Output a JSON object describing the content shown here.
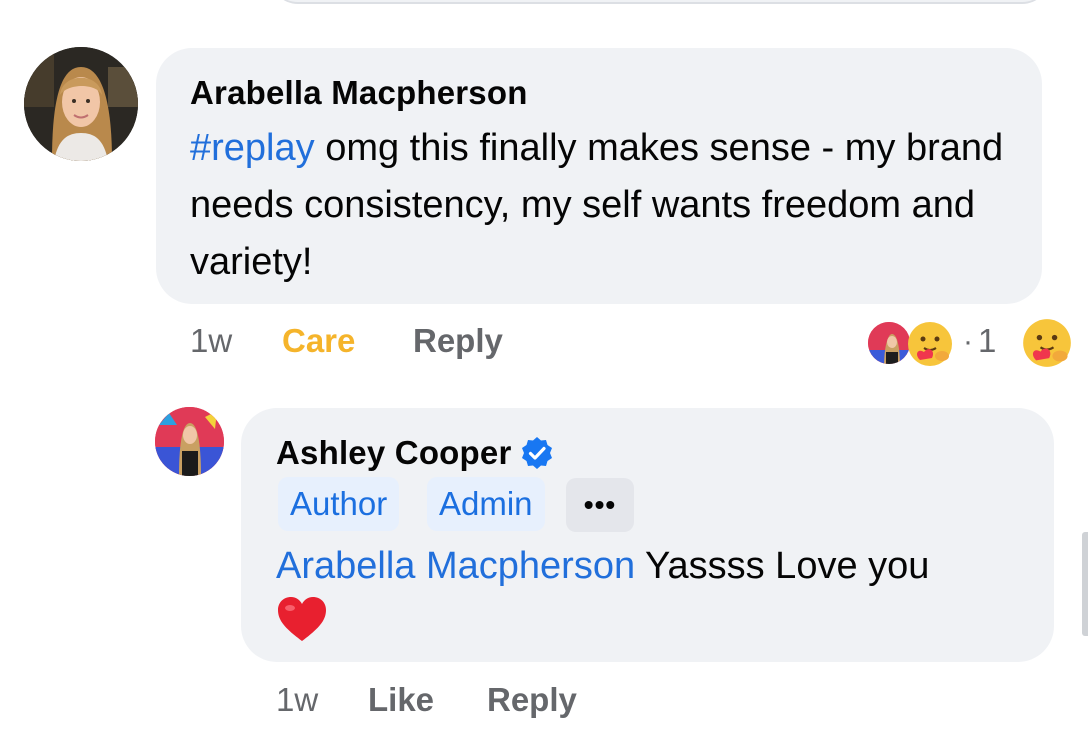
{
  "comment1": {
    "author": "Arabella Macpherson",
    "hashtag": "#replay",
    "text": " omg this finally makes sense - my brand needs consistency, my self wants freedom and variety!",
    "time": "1w",
    "reaction_button": "Care",
    "reply_label": "Reply",
    "reaction_count": "1",
    "reaction_icon": "care-emoji-icon"
  },
  "comment2": {
    "author": "Ashley Cooper",
    "verified_icon": "verified-badge-icon",
    "badges": [
      "Author",
      "Admin"
    ],
    "more_label": "•••",
    "mention": "Arabella Macpherson",
    "text": " Yassss Love you",
    "emoji": "❤️",
    "time": "1w",
    "like_label": "Like",
    "reply_label": "Reply"
  },
  "colors": {
    "bubble": "#f0f2f5",
    "link": "#216fdb",
    "care": "#f5b42b",
    "meta": "#65676b",
    "badge_bg": "#e7f0fd",
    "verified": "#1877f2"
  }
}
